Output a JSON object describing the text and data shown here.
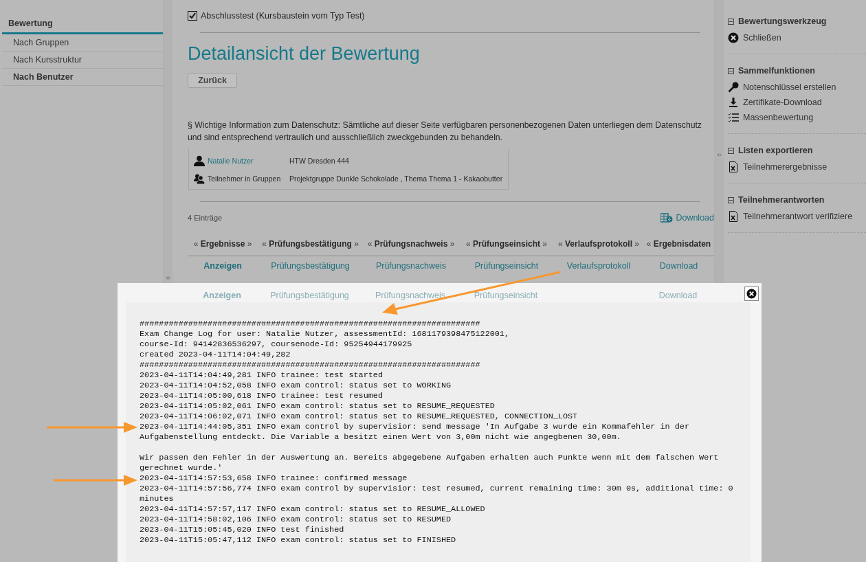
{
  "sidebar": {
    "title": "Bewertung",
    "items": [
      {
        "label": "Nach Gruppen",
        "selected": false
      },
      {
        "label": "Nach Kursstruktur",
        "selected": false
      },
      {
        "label": "Nach Benutzer",
        "selected": true
      }
    ]
  },
  "main": {
    "node": {
      "label": "Abschlusstest (Kursbaustein vom Typ Test)",
      "checked": true
    },
    "title": "Detailansicht der Bewertung",
    "back_button": "Zurück",
    "privacy_notice": "§ Wichtige Information zum Datenschutz: Sämtliche auf dieser Seite verfügbaren personenbezogenen Daten unterliegen dem Datenschutz und sind entsprechend vertraulich und ausschließlich zweckgebunden zu behandeln.",
    "user_info": [
      {
        "kind": "user",
        "label": "Natalie Nutzer",
        "value": "HTW Dresden 444"
      },
      {
        "kind": "groups",
        "label": "Teilnehmer in Gruppen",
        "value": "Projektgruppe Dunkle Schokolade , Thema Thema 1 - Kakaobutter"
      }
    ],
    "entry_count": "4 Einträge",
    "download": "Download",
    "table": {
      "columns": [
        "« **Ergebnisse** »",
        "« **Prüfungsbestätigung** »",
        "« **Prüfungsnachweis** »",
        "« **Prüfungseinsicht** »",
        "« **Verlaufsprotokoll** »",
        "« **Ergebnisdaten**"
      ],
      "rows": [
        [
          "Anzeigen",
          "Prüfungsbestätigung",
          "Prüfungsnachweis",
          "Prüfungseinsicht",
          "Verlaufsprotokoll",
          "Download"
        ],
        [
          "Anzeigen",
          "Prüfungsbestätigung",
          "Prüfungsnachweis",
          "Prüfungseinsicht"
        ]
      ],
      "row_2_last": "Download"
    }
  },
  "tools": [
    {
      "title": "Bewertungswerkzeug",
      "items": [
        {
          "kind": "close",
          "label": "Schließen"
        }
      ]
    },
    {
      "title": "Sammelfunktionen",
      "items": [
        {
          "kind": "key",
          "label": "Notenschlüssel erstellen"
        },
        {
          "kind": "download",
          "label": "Zertifikate-Download"
        },
        {
          "kind": "checklist",
          "label": "Massenbewertung"
        }
      ]
    },
    {
      "title": "Listen exportieren",
      "items": [
        {
          "kind": "excel",
          "label": "Teilnehmerergebnisse"
        }
      ]
    },
    {
      "title": "Teilnehmerantworten",
      "items": [
        {
          "kind": "excel",
          "label": "Teilnehmerantwort verifiziere"
        }
      ]
    }
  ],
  "dialog": {
    "log": [
      "######################################################################",
      "Exam Change Log for user: Natalie Nutzer, assessmentId: 1681179398475122001,",
      "course-Id: 94142836536297, coursenode-Id: 95254944179925",
      "created 2023-04-11T14:04:49,282",
      "######################################################################",
      "2023-04-11T14:04:49,281 INFO trainee: test started",
      "2023-04-11T14:04:52,058 INFO exam control: status set to WORKING",
      "2023-04-11T14:05:00,618 INFO trainee: test resumed",
      "2023-04-11T14:05:02,061 INFO exam control: status set to RESUME_REQUESTED",
      "2023-04-11T14:06:02,071 INFO exam control: status set to RESUME_REQUESTED, CONNECTION_LOST",
      "2023-04-11T14:44:05,351 INFO exam control by supervisior: send message 'In Aufgabe 3 wurde ein Kommafehler in der Aufgabenstellung entdeckt. Die Variable a besitzt einen Wert von 3,00m nicht wie angegbenen 30,00m.\n\nWir passen den Fehler in der Auswertung an. Bereits abgegebene Aufgaben erhalten auch Punkte wenn mit dem falschen Wert gerechnet wurde.'",
      "2023-04-11T14:57:53,658 INFO trainee: confirmed message",
      "2023-04-11T14:57:56,774 INFO exam control by supervisior: test resumed, current remaining time: 30m 0s, additional time: 0 minutes",
      "2023-04-11T14:57:57,117 INFO exam control: status set to RESUME_ALLOWED",
      "2023-04-11T14:58:02,106 INFO exam control: status set to RESUMED",
      "2023-04-11T15:05:45,020 INFO test finished",
      "2023-04-11T15:05:47,112 INFO exam control: status set to FINISHED"
    ]
  }
}
